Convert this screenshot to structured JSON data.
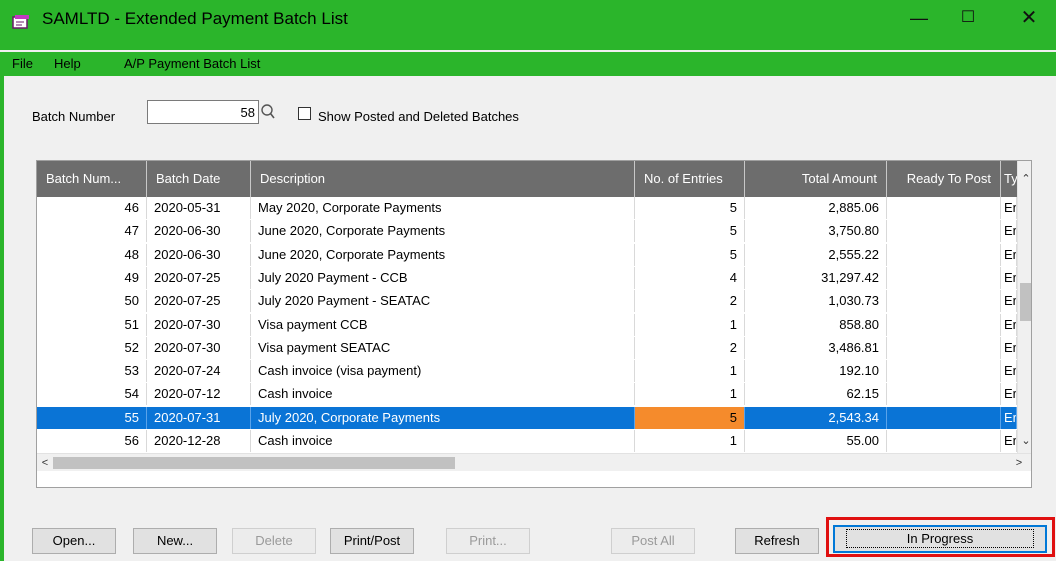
{
  "window": {
    "title": "SAMLTD - Extended Payment Batch List",
    "controls": {
      "minimize": "—",
      "maximize": "☐",
      "close": "✕"
    }
  },
  "menu": {
    "file": "File",
    "help": "Help",
    "title": "A/P Payment Batch List"
  },
  "filters": {
    "batch_label": "Batch Number",
    "batch_value": "58",
    "show_posted_label": "Show Posted and Deleted Batches",
    "show_posted_checked": false
  },
  "grid": {
    "columns": [
      "Batch Num...",
      "Batch Date",
      "Description",
      "No. of Entries",
      "Total Amount",
      "Ready To Post",
      "Ty"
    ],
    "rows": [
      {
        "num": "46",
        "date": "2020-05-31",
        "desc": "May 2020, Corporate Payments",
        "entries": "5",
        "amount": "2,885.06",
        "ready": "",
        "type": "Er"
      },
      {
        "num": "47",
        "date": "2020-06-30",
        "desc": "June 2020, Corporate Payments",
        "entries": "5",
        "amount": "3,750.80",
        "ready": "",
        "type": "Er"
      },
      {
        "num": "48",
        "date": "2020-06-30",
        "desc": "June 2020, Corporate Payments",
        "entries": "5",
        "amount": "2,555.22",
        "ready": "",
        "type": "Er"
      },
      {
        "num": "49",
        "date": "2020-07-25",
        "desc": "July 2020 Payment - CCB",
        "entries": "4",
        "amount": "31,297.42",
        "ready": "",
        "type": "Er"
      },
      {
        "num": "50",
        "date": "2020-07-25",
        "desc": "July 2020 Payment - SEATAC",
        "entries": "2",
        "amount": "1,030.73",
        "ready": "",
        "type": "Er"
      },
      {
        "num": "51",
        "date": "2020-07-30",
        "desc": "Visa payment CCB",
        "entries": "1",
        "amount": "858.80",
        "ready": "",
        "type": "Er"
      },
      {
        "num": "52",
        "date": "2020-07-30",
        "desc": "Visa payment SEATAC",
        "entries": "2",
        "amount": "3,486.81",
        "ready": "",
        "type": "Er"
      },
      {
        "num": "53",
        "date": "2020-07-24",
        "desc": "Cash invoice (visa payment)",
        "entries": "1",
        "amount": "192.10",
        "ready": "",
        "type": "Er"
      },
      {
        "num": "54",
        "date": "2020-07-12",
        "desc": "Cash invoice",
        "entries": "1",
        "amount": "62.15",
        "ready": "",
        "type": "Er"
      },
      {
        "num": "55",
        "date": "2020-07-31",
        "desc": "July 2020, Corporate Payments",
        "entries": "5",
        "amount": "2,543.34",
        "ready": "",
        "type": "Er"
      },
      {
        "num": "56",
        "date": "2020-12-28",
        "desc": "Cash invoice",
        "entries": "1",
        "amount": "55.00",
        "ready": "",
        "type": "Er"
      }
    ],
    "selected_batch": "55"
  },
  "buttons": {
    "open": "Open...",
    "new": "New...",
    "delete": "Delete",
    "print_post": "Print/Post",
    "print": "Print...",
    "post_all": "Post All",
    "refresh": "Refresh",
    "in_progress": "In Progress"
  },
  "colors": {
    "title_bar": "#2bb52b",
    "header": "#6d6d6d",
    "selection": "#0a74d6",
    "highlight_cell": "#f58b2c",
    "callout": "#e01010"
  }
}
